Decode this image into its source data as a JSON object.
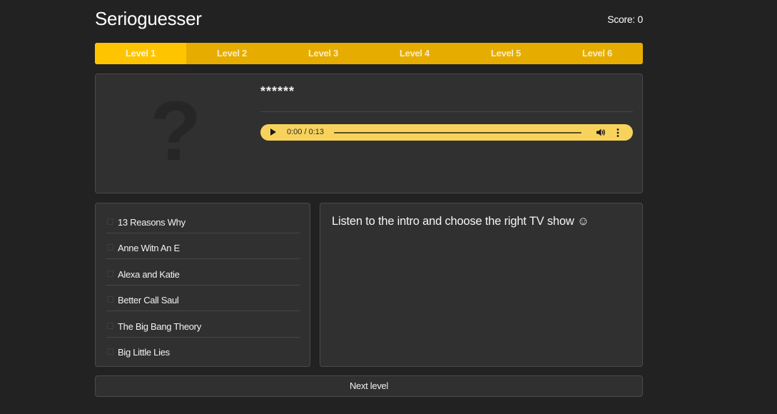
{
  "app": {
    "title": "Serioguesser",
    "score_label": "Score: 0"
  },
  "levels": [
    {
      "label": "Level 1",
      "active": true
    },
    {
      "label": "Level 2",
      "active": false
    },
    {
      "label": "Level 3",
      "active": false
    },
    {
      "label": "Level 4",
      "active": false
    },
    {
      "label": "Level 5",
      "active": false
    },
    {
      "label": "Level 6",
      "active": false
    }
  ],
  "player": {
    "placeholder_glyph": "?",
    "masked_title": "******",
    "audio": {
      "time": "0:00 / 0:13",
      "progress": 0,
      "icons": [
        "play-icon",
        "volume-icon",
        "more-options-icon"
      ]
    }
  },
  "choices": [
    "13 Reasons Why",
    "Anne Witn An E",
    "Alexa and Katie",
    "Better Call Saul",
    "The Big Bang Theory",
    "Big Little Lies"
  ],
  "info": {
    "message": "Listen to the intro and choose the right TV show ☺"
  },
  "actions": {
    "next_level_label": "Next level"
  },
  "colors": {
    "background": "#222222",
    "panel": "#303030",
    "accent": "#ffc400",
    "accent_dark": "#e6ad00",
    "audio_bar": "#f8d35c"
  }
}
